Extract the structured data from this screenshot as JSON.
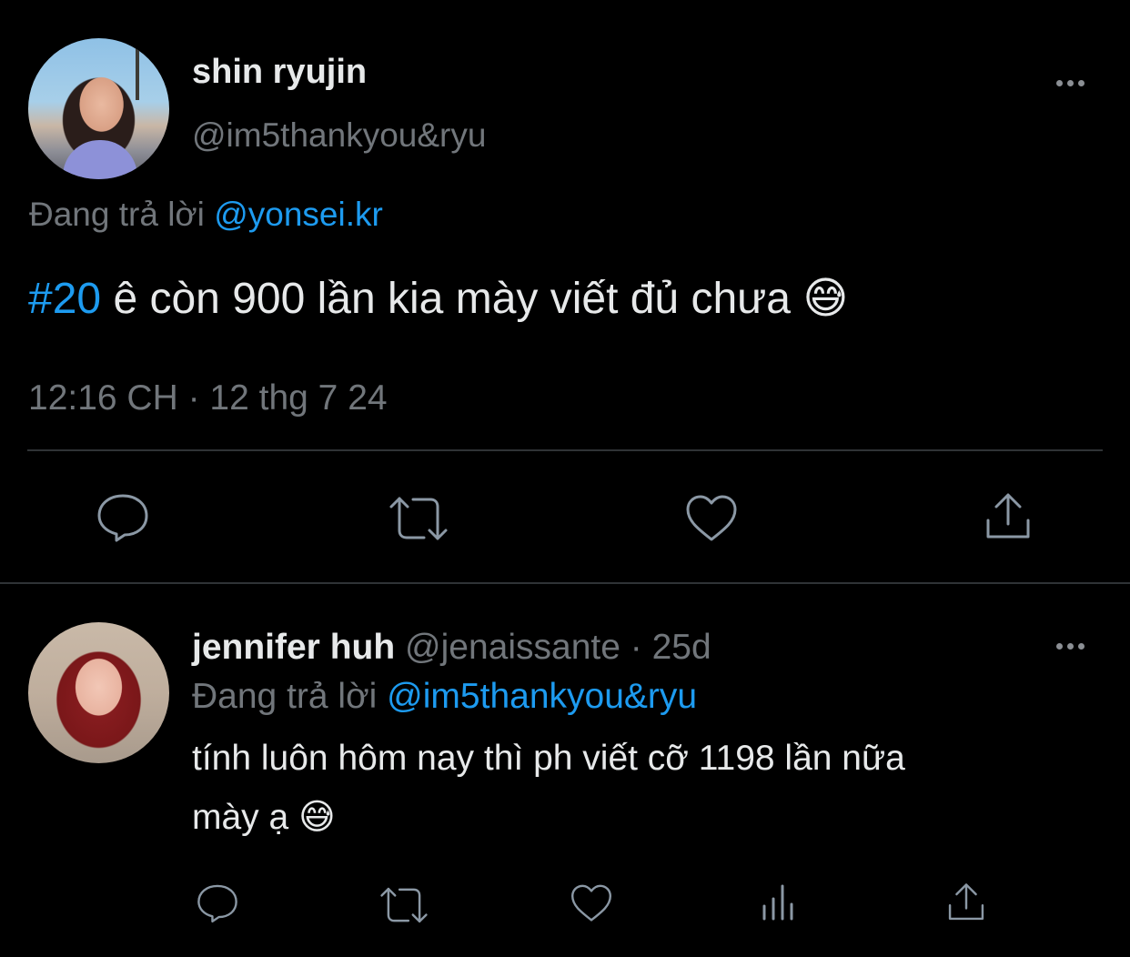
{
  "tweet": {
    "display_name": "shin ryujin",
    "handle": "@im5thankyou&ryu",
    "replying_label": "Đang trả lời",
    "replying_to": "@yonsei.kr",
    "hashtag": "#20",
    "text": "ê còn 900 lần kia mày viết đủ chưa",
    "emoji": "😅",
    "timestamp": "12:16 CH · 12 thg 7 24",
    "actions": [
      "reply-icon",
      "retweet-icon",
      "like-icon",
      "share-icon"
    ]
  },
  "reply": {
    "display_name": "jennifer huh",
    "handle": "@jenaissante",
    "separator": "·",
    "age": "25d",
    "replying_label": "Đang trả lời",
    "replying_to": "@im5thankyou&ryu",
    "text_line1": "tính luôn hôm nay thì ph viết cỡ 1198 lần nữa",
    "text_line2": "mày ạ",
    "emoji": "😅",
    "actions": [
      "reply-icon",
      "retweet-icon",
      "like-icon",
      "analytics-icon",
      "share-icon"
    ]
  },
  "colors": {
    "background": "#000000",
    "text": "#e7e9ea",
    "muted": "#71767b",
    "link": "#1d9bf0",
    "divider": "#2f3336"
  }
}
